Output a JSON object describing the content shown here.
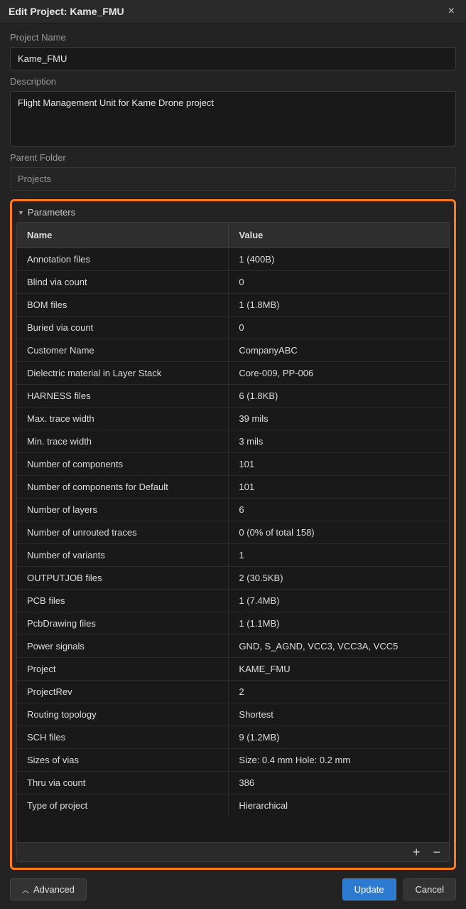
{
  "window": {
    "title": "Edit Project: Kame_FMU"
  },
  "fields": {
    "project_name_label": "Project Name",
    "project_name_value": "Kame_FMU",
    "description_label": "Description",
    "description_value": "Flight Management Unit for Kame Drone project",
    "parent_folder_label": "Parent Folder",
    "parent_folder_value": "Projects"
  },
  "parameters": {
    "section_title": "Parameters",
    "columns": {
      "name": "Name",
      "value": "Value"
    },
    "rows": [
      {
        "name": "Annotation files",
        "value": "1 (400B)"
      },
      {
        "name": "Blind via count",
        "value": "0"
      },
      {
        "name": "BOM files",
        "value": "1 (1.8MB)"
      },
      {
        "name": "Buried via count",
        "value": "0"
      },
      {
        "name": "Customer Name",
        "value": "CompanyABC"
      },
      {
        "name": "Dielectric material in Layer Stack",
        "value": "Core-009, PP-006"
      },
      {
        "name": "HARNESS files",
        "value": "6 (1.8KB)"
      },
      {
        "name": "Max. trace width",
        "value": "39 mils"
      },
      {
        "name": "Min. trace width",
        "value": "3 mils"
      },
      {
        "name": "Number of components",
        "value": "101"
      },
      {
        "name": "Number of components for Default",
        "value": "101"
      },
      {
        "name": "Number of layers",
        "value": "6"
      },
      {
        "name": "Number of unrouted traces",
        "value": "0 (0% of total 158)"
      },
      {
        "name": "Number of variants",
        "value": "1"
      },
      {
        "name": "OUTPUTJOB files",
        "value": "2 (30.5KB)"
      },
      {
        "name": "PCB files",
        "value": "1 (7.4MB)"
      },
      {
        "name": "PcbDrawing files",
        "value": "1 (1.1MB)"
      },
      {
        "name": "Power signals",
        "value": "GND, S_AGND, VCC3, VCC3A, VCC5"
      },
      {
        "name": "Project",
        "value": "KAME_FMU"
      },
      {
        "name": "ProjectRev",
        "value": "2"
      },
      {
        "name": "Routing topology",
        "value": "Shortest"
      },
      {
        "name": "SCH files",
        "value": "9 (1.2MB)"
      },
      {
        "name": "Sizes of vias",
        "value": "Size: 0.4 mm Hole: 0.2 mm"
      },
      {
        "name": "Thru via count",
        "value": "386"
      },
      {
        "name": "Type of project",
        "value": "Hierarchical"
      }
    ]
  },
  "buttons": {
    "advanced": "Advanced",
    "update": "Update",
    "cancel": "Cancel"
  }
}
